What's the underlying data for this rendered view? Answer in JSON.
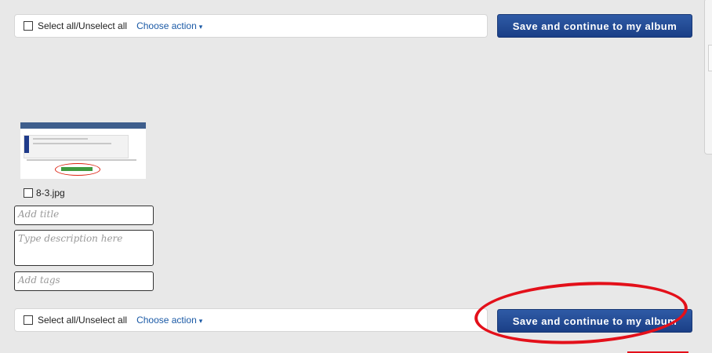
{
  "top_toolbar": {
    "select_all_label": "Select all/Unselect all",
    "action_label": "Choose action",
    "caret": "▾"
  },
  "bottom_toolbar": {
    "select_all_label": "Select all/Unselect all",
    "action_label": "Choose action",
    "caret": "▾"
  },
  "save_button": {
    "label": "Save and continue to my album"
  },
  "photo": {
    "filename": "8-3.jpg",
    "title_placeholder": "Add title",
    "description_placeholder": "Type description here",
    "tags_placeholder": "Add tags"
  },
  "colors": {
    "button_blue": "#1f4a95",
    "link_blue": "#1b5aa6",
    "annotation_red": "#e3101a",
    "background": "#e8e8e8"
  }
}
